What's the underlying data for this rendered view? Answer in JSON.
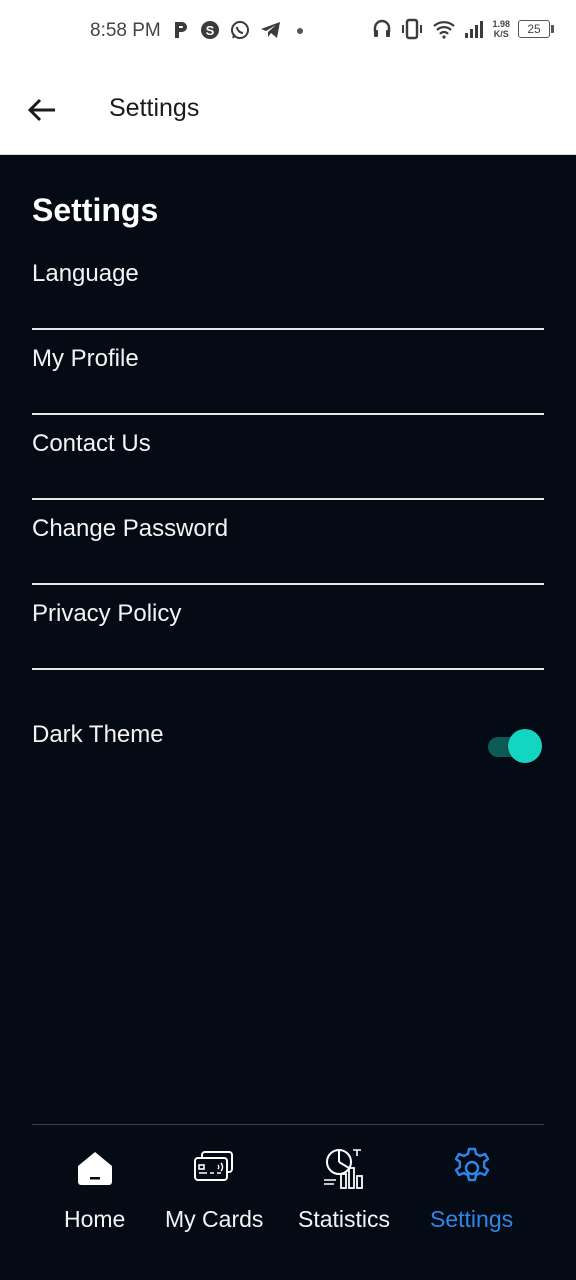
{
  "status_bar": {
    "time": "8:58 PM",
    "net_speed_value": "1.98",
    "net_speed_unit": "K/S",
    "battery": "25"
  },
  "app_bar": {
    "title": "Settings"
  },
  "section": {
    "title": "Settings"
  },
  "menu": {
    "items": [
      {
        "label": "Language"
      },
      {
        "label": "My Profile"
      },
      {
        "label": "Contact Us"
      },
      {
        "label": "Change Password"
      },
      {
        "label": "Privacy Policy"
      }
    ]
  },
  "dark_theme": {
    "label": "Dark Theme",
    "enabled": true
  },
  "bottom_nav": {
    "items": [
      {
        "label": "Home",
        "icon": "home-icon"
      },
      {
        "label": "My Cards",
        "icon": "card-icon"
      },
      {
        "label": "Statistics",
        "icon": "statistics-icon"
      },
      {
        "label": "Settings",
        "icon": "gear-icon"
      }
    ],
    "active_index": 3
  },
  "colors": {
    "background": "#040b14",
    "accent_active": "#2f86e8",
    "toggle_thumb": "#13d6c2",
    "toggle_track": "#0d5b58"
  }
}
